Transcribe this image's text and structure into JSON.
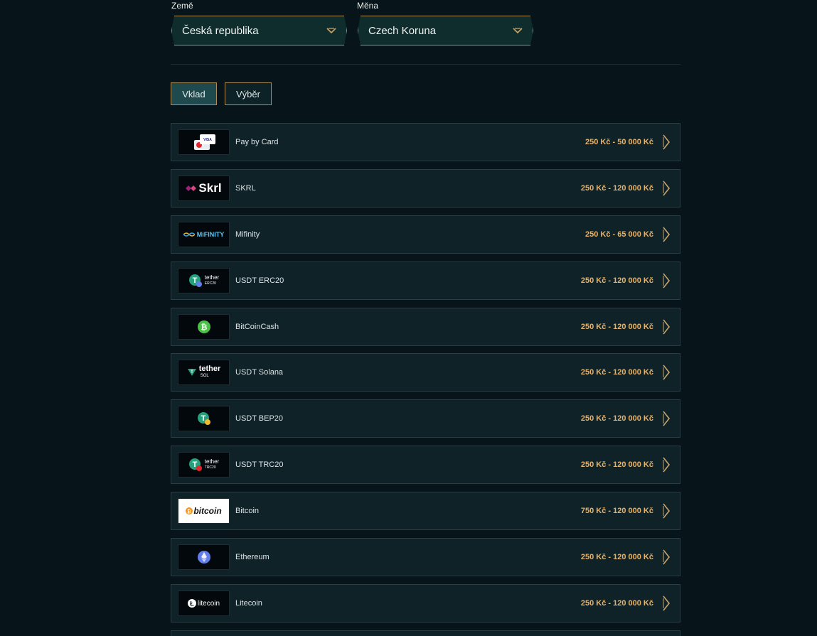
{
  "country": {
    "label": "Země",
    "value": "Česká republika"
  },
  "currency": {
    "label": "Měna",
    "value": "Czech Koruna"
  },
  "tabs": [
    {
      "label": "Vklad",
      "active": true
    },
    {
      "label": "Výběr",
      "active": false
    }
  ],
  "methods": [
    {
      "name": "Pay by Card",
      "range": "250 Kč - 50 000 Kč",
      "logo": "card-icon"
    },
    {
      "name": "SKRL",
      "range": "250 Kč - 120 000 Kč",
      "logo": "skrill-logo",
      "logo_text": "Skrl"
    },
    {
      "name": "Mifinity",
      "range": "250 Kč - 65 000 Kč",
      "logo": "mifinity-logo",
      "logo_text": "MiFINITY"
    },
    {
      "name": "USDT ERC20",
      "range": "250 Kč - 120 000 Kč",
      "logo": "tether-erc20-logo",
      "logo_text": "tether",
      "logo_sub": "ERC20"
    },
    {
      "name": "BitCoinCash",
      "range": "250 Kč - 120 000 Kč",
      "logo": "bitcoincash-icon"
    },
    {
      "name": "USDT Solana",
      "range": "250 Kč - 120 000 Kč",
      "logo": "tether-sol-logo",
      "logo_text": "tether",
      "logo_sub": "SOL"
    },
    {
      "name": "USDT BEP20",
      "range": "250 Kč - 120 000 Kč",
      "logo": "tether-bep20-icon"
    },
    {
      "name": "USDT TRC20",
      "range": "250 Kč - 120 000 Kč",
      "logo": "tether-trc20-logo",
      "logo_text": "tether",
      "logo_sub": "TRC20"
    },
    {
      "name": "Bitcoin",
      "range": "750 Kč - 120 000 Kč",
      "logo": "bitcoin-logo",
      "logo_text": "bitcoin"
    },
    {
      "name": "Ethereum",
      "range": "250 Kč - 120 000 Kč",
      "logo": "ethereum-icon"
    },
    {
      "name": "Litecoin",
      "range": "250 Kč - 120 000 Kč",
      "logo": "litecoin-logo",
      "logo_text": "litecoin"
    }
  ],
  "colors": {
    "accent": "#b08c58",
    "range": "#e7b36a",
    "background": "#071419",
    "row": "#0f2228"
  }
}
